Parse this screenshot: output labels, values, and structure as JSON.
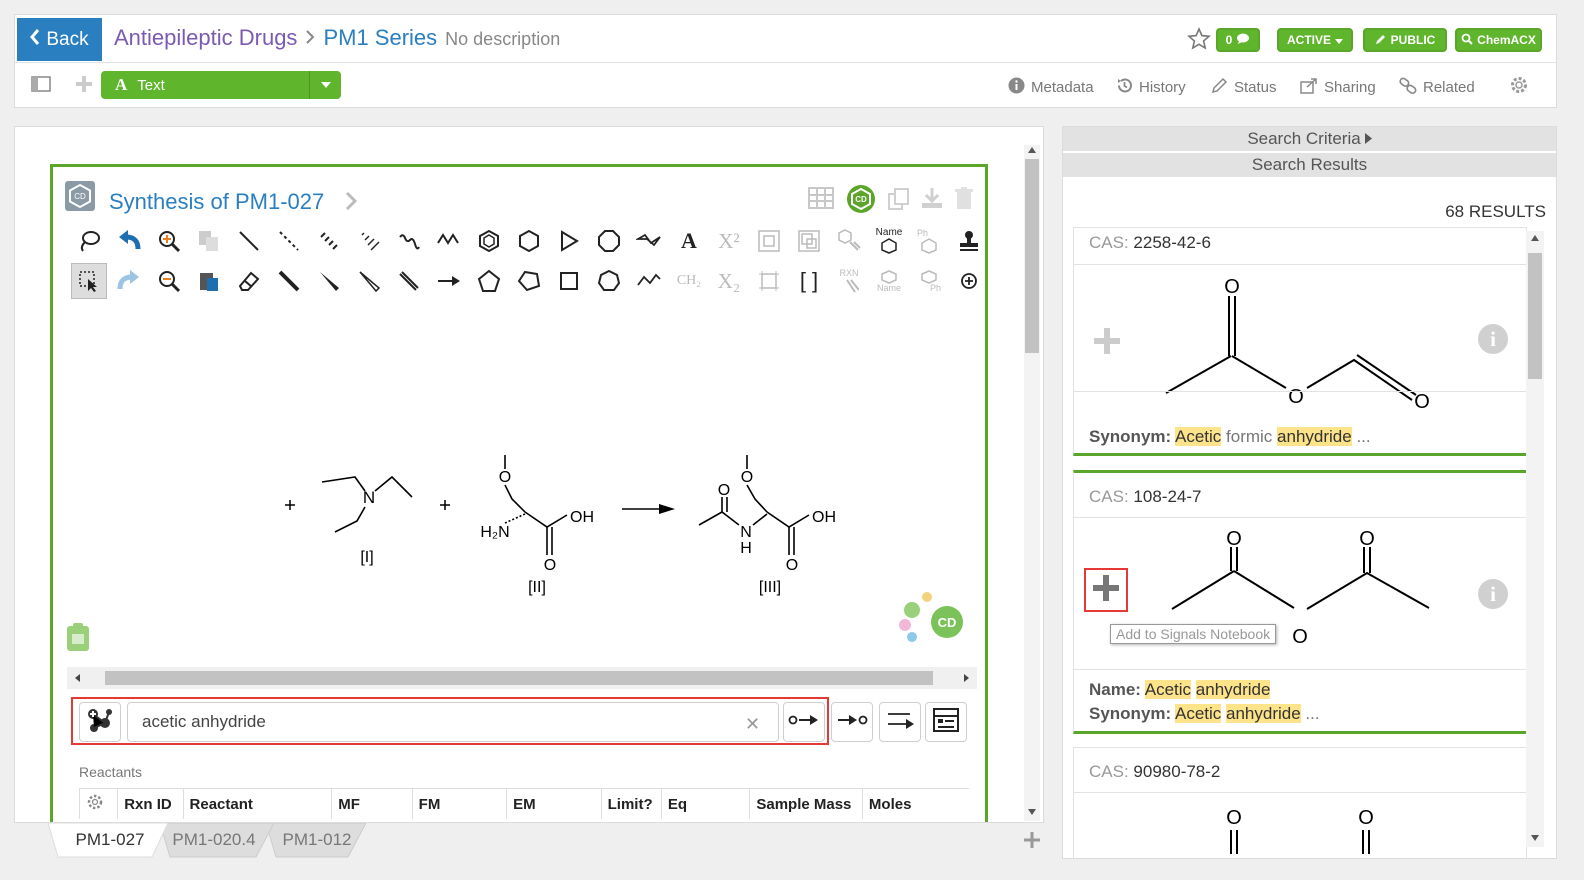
{
  "header": {
    "back_label": "Back",
    "breadcrumb_parent": "Antiepileptic Drugs",
    "breadcrumb_current": "PM1 Series",
    "description": "No description",
    "comment_count": "0",
    "status_badge": "ACTIVE",
    "visibility_badge": "PUBLIC",
    "chemacx_badge": "ChemACX",
    "colors": {
      "accent_blue": "#2a7fc0",
      "green": "#5aa52a",
      "purple": "#7b5ab3"
    }
  },
  "toolbar": {
    "text_dropdown_label": "Text",
    "nav": [
      {
        "label": "Metadata",
        "icon": "info-circle-icon"
      },
      {
        "label": "History",
        "icon": "history-icon"
      },
      {
        "label": "Status",
        "icon": "pencil-icon"
      },
      {
        "label": "Sharing",
        "icon": "share-icon"
      },
      {
        "label": "Related",
        "icon": "link-icon"
      }
    ]
  },
  "entry": {
    "title": "Synthesis of PM1-027",
    "compound_labels": [
      "[I]",
      "[II]",
      "[III]"
    ],
    "atom_labels": {
      "n": "N",
      "o": "O",
      "oh": "OH",
      "h2n": "H₂N",
      "h": "H"
    },
    "search_value": "acetic anhydride",
    "reactants_label": "Reactants",
    "table_headers": [
      "Rxn ID",
      "Reactant",
      "MF",
      "FM",
      "EM",
      "Limit?",
      "Eq",
      "Sample Mass",
      "Moles"
    ],
    "toolbar_text_glyphs": {
      "x2_sup": "X²",
      "x2_sub": "X₂",
      "ch2": "CH₂",
      "name": "Name",
      "ph": "Ph",
      "rxn": "RXN",
      "a": "A",
      "cd": "CD"
    }
  },
  "tabs": [
    "PM1-027",
    "PM1-020.4",
    "PM1-012"
  ],
  "search_panel": {
    "criteria_label": "Search Criteria",
    "results_label": "Search Results",
    "results_count": "68 RESULTS",
    "cas_key": "CAS:",
    "name_key": "Name:",
    "synonym_key": "Synonym:",
    "o_label": "O",
    "tooltip": "Add to Signals Notebook",
    "results": [
      {
        "cas": "2258-42-6",
        "synonym_parts": [
          "Acetic",
          "formic",
          "anhydride",
          "..."
        ]
      },
      {
        "cas": "108-24-7",
        "name_parts": [
          "Acetic",
          "anhydride"
        ],
        "synonym_parts": [
          "Acetic",
          "anhydride",
          "..."
        ]
      },
      {
        "cas": "90980-78-2"
      }
    ]
  }
}
